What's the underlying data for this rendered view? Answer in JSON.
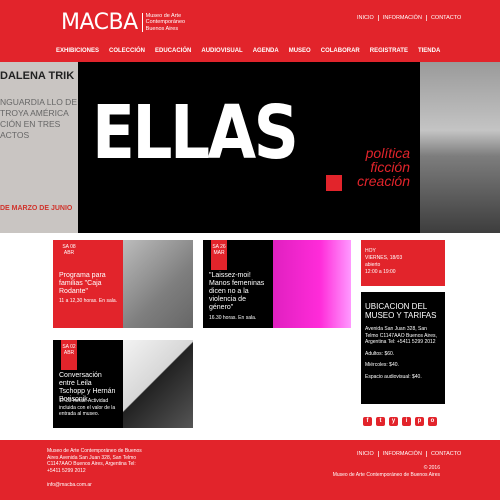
{
  "header": {
    "logo_text": "MACBA",
    "logo_sub": "Museo de Arte Contemporáneo Buenos Aires",
    "topnav": [
      "INICIO",
      "INFORMACIÓN",
      "CONTACTO"
    ],
    "mainnav": [
      "EXHIBICIONES",
      "COLECCIÓN",
      "EDUCACIÓN",
      "AUDIOVISUAL",
      "AGENDA",
      "MUSEO",
      "COLABORAR",
      "REGISTRATE",
      "TIENDA"
    ]
  },
  "hero": {
    "left_title": "DALENA TRIK",
    "left_sub": "NGUARDIA LLO DE TROYA AMÉRICA CIÓN EN TRES ACTOS",
    "left_dates": "DE MARZO DE JUNIO",
    "title": "ELLAS",
    "sub": "política ficción creación"
  },
  "cards": [
    {
      "badge": "SA 08 ABR",
      "title": "Programa para familias \"Caja Rodante\"",
      "text": "11 a 12,30 horas. En sala."
    },
    {
      "badge": "SA 26 MAR",
      "title": "\"Laissez-moi! Manos femeninas dicen no a la violencia de género\"",
      "text": "16.30 horas. En sala."
    },
    {
      "badge": "SA 02 ABR",
      "title": "Conversación entre Leila Tschopp y Hernán Borisonik",
      "text": "17.30 horas. Actividad incluida con el valor de la entrada al museo."
    }
  ],
  "sidebar": {
    "today": "HOY",
    "date": "VIERNES, 18/03",
    "status": "abierto",
    "hours": "12:00 a 19:00",
    "info_title": "UBICACION DEL MUSEO Y TARIFAS",
    "address": "Avenida San Juan 328, San Telmo C1147AAO Buenos Aires, Argentina Tel: +5411 5299 2012",
    "adults": "Adultos: $60.",
    "wednesday": "Miércoles: $40.",
    "audiovisual": "Espacio audiovisual: $40."
  },
  "social": [
    "f",
    "t",
    "y",
    "i",
    "p",
    "o"
  ],
  "footer": {
    "left": "Museo de Arte Contemporáneo de Buenos Aires Avenida San Juan 328, San Telmo C1147AAO Buenos Aires, Argentina Tel: +5411 5299 2012",
    "email": "info@macba.com.ar",
    "nav": [
      "INICIO",
      "INFORMACIÓN",
      "CONTACTO"
    ],
    "copyright": "© 2016",
    "museum": "Museo de Arte Contemporáneo de Buenos Aires"
  }
}
